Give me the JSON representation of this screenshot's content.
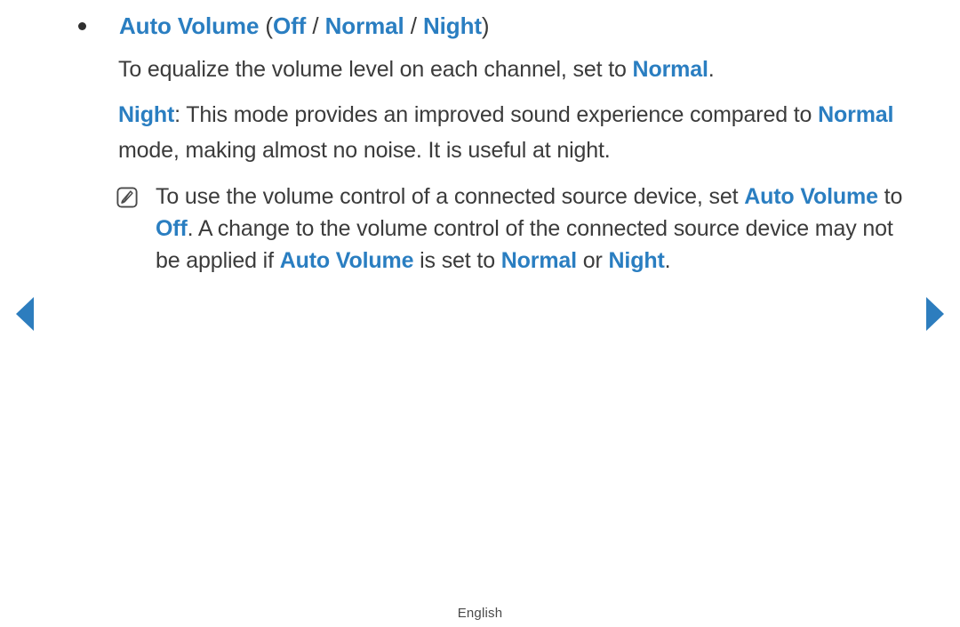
{
  "page": {
    "background_color": "#ffffff",
    "text_color": "#3b3b3b",
    "accent_color": "#2a7ec1",
    "arrow_color": "#2d7dbe"
  },
  "heading": {
    "bullet_glyph": "•",
    "term": "Auto Volume",
    "open_paren": " (",
    "option_off": "Off",
    "sep1": " / ",
    "option_normal": "Normal",
    "sep2": " / ",
    "option_night": "Night",
    "close_paren": ")"
  },
  "paragraphs": [
    {
      "id": "equalize",
      "part1": "To equalize the volume level on each channel, set to ",
      "kw1": "Normal",
      "part2": "."
    },
    {
      "id": "night-description",
      "kw1": "Night",
      "part1": ": This mode provides an improved sound experience compared to ",
      "kw2": "Normal",
      "part2": " mode, making almost no noise. It is useful at night."
    }
  ],
  "note": {
    "icon_name": "note-pen-icon",
    "part1": "To use the volume control of a connected source device, set ",
    "kw1": "Auto Volume",
    "part2": " to ",
    "kw2": "Off",
    "part3": ". A change to the volume control of the connected source device may not be applied if ",
    "kw3": "Auto Volume",
    "part4": " is set to ",
    "kw4": "Normal",
    "part5": " or ",
    "kw5": "Night",
    "part6": "."
  },
  "navigation": {
    "prev_label": "◀",
    "next_label": "▶",
    "prev_name": "previous-page-arrow",
    "next_name": "next-page-arrow"
  },
  "footer": {
    "language": "English"
  }
}
